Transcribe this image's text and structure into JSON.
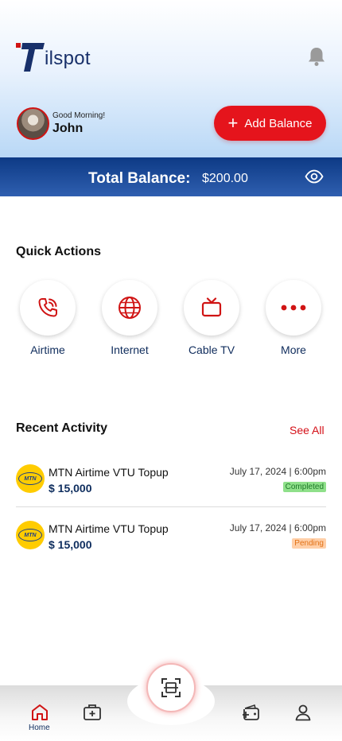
{
  "header": {
    "logo_text": "ilspot",
    "greeting": "Good Morning!",
    "user_name": "John",
    "add_balance_label": "Add Balance",
    "add_balance_icon": "plus-icon"
  },
  "balance": {
    "label": "Total Balance:",
    "value": "$200.00"
  },
  "quick_actions": {
    "title": "Quick Actions",
    "items": [
      {
        "label": "Airtime",
        "icon": "phone-icon"
      },
      {
        "label": "Internet",
        "icon": "globe-icon"
      },
      {
        "label": "Cable TV",
        "icon": "tv-icon"
      },
      {
        "label": "More",
        "icon": "more-dots-icon"
      }
    ]
  },
  "recent": {
    "title": "Recent Activity",
    "see_all": "See All",
    "items": [
      {
        "logo": "MTN",
        "title": "MTN Airtime VTU Topup",
        "amount": "$ 15,000",
        "date": "July 17, 2024 | 6:00pm",
        "status": "Completed"
      },
      {
        "logo": "MTN",
        "title": "MTN Airtime VTU Topup",
        "amount": "$ 15,000",
        "date": "July 17, 2024 | 6:00pm",
        "status": "Pending"
      }
    ]
  },
  "nav": {
    "home_label": "Home"
  },
  "colors": {
    "brand_red": "#e5141c",
    "brand_navy": "#0d3a85",
    "completed": "#8fe08a",
    "pending": "#ffcfa8"
  }
}
